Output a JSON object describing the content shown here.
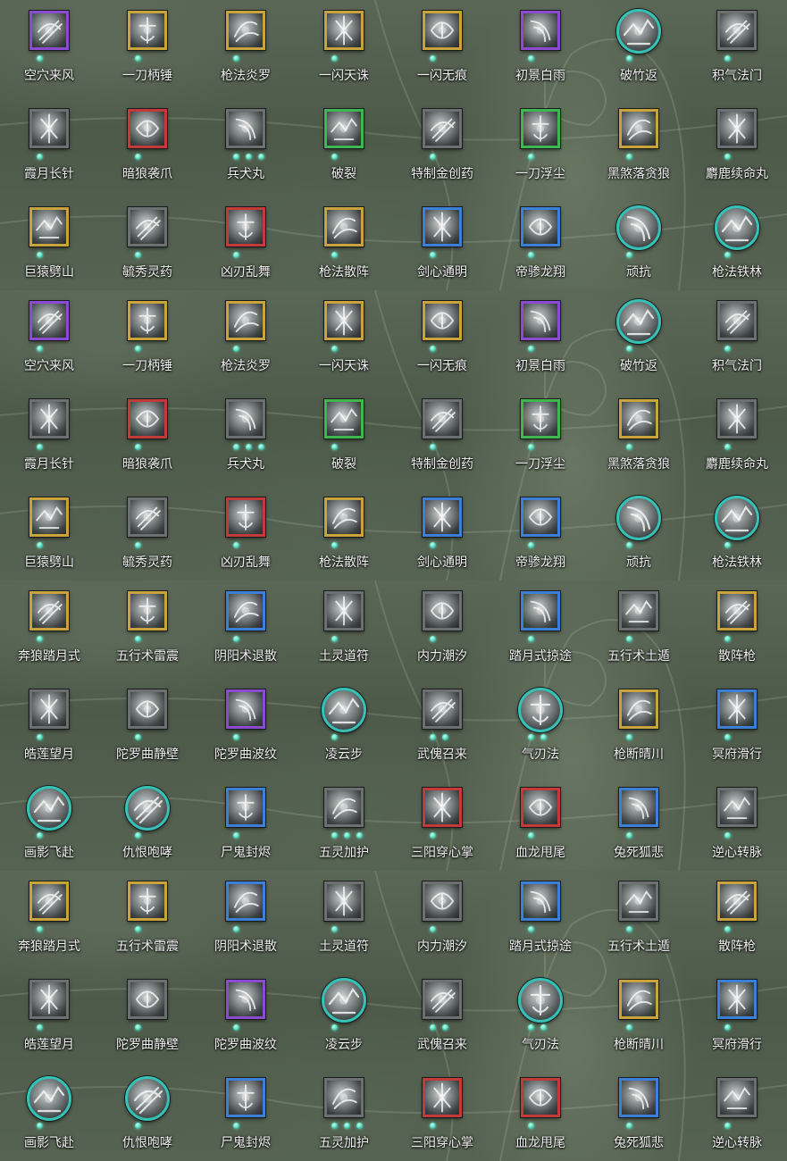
{
  "panels": [
    {
      "rows": [
        [
          {
            "name": "空穴来风",
            "frame": "purple",
            "dots": 1
          },
          {
            "name": "一刀柄锤",
            "frame": "gold",
            "dots": 1
          },
          {
            "name": "枪法炎罗",
            "frame": "gold",
            "dots": 1
          },
          {
            "name": "一闪天诛",
            "frame": "gold",
            "dots": 1
          },
          {
            "name": "一闪无痕",
            "frame": "gold",
            "dots": 1
          },
          {
            "name": "初景白雨",
            "frame": "purple",
            "dots": 1
          },
          {
            "name": "破竹返",
            "frame": "teal-circle",
            "dots": 1
          },
          {
            "name": "积气法门",
            "frame": "gray",
            "dots": 1
          }
        ],
        [
          {
            "name": "霞月长针",
            "frame": "gray",
            "dots": 1
          },
          {
            "name": "暗狼袭爪",
            "frame": "red",
            "dots": 1
          },
          {
            "name": "兵犬丸",
            "frame": "gray",
            "dots": 3
          },
          {
            "name": "破裂",
            "frame": "green",
            "dots": 1
          },
          {
            "name": "特制金创药",
            "frame": "gray",
            "dots": 1
          },
          {
            "name": "一刀浮尘",
            "frame": "green",
            "dots": 1
          },
          {
            "name": "黑煞落贪狼",
            "frame": "gold",
            "dots": 1
          },
          {
            "name": "麝鹿续命丸",
            "frame": "gray",
            "dots": 1
          }
        ],
        [
          {
            "name": "巨猿劈山",
            "frame": "gold",
            "dots": 1
          },
          {
            "name": "毓秀灵药",
            "frame": "gray",
            "dots": 1
          },
          {
            "name": "凶刃乱舞",
            "frame": "red",
            "dots": 1
          },
          {
            "name": "枪法散阵",
            "frame": "gold",
            "dots": 1
          },
          {
            "name": "剑心通明",
            "frame": "blue",
            "dots": 1
          },
          {
            "name": "帝骖龙翔",
            "frame": "blue",
            "dots": 1
          },
          {
            "name": "顽抗",
            "frame": "teal-circle",
            "dots": 1
          },
          {
            "name": "枪法铁林",
            "frame": "teal-circle",
            "dots": 1
          }
        ]
      ]
    },
    {
      "rows": [
        [
          {
            "name": "空穴来风",
            "frame": "purple",
            "dots": 1
          },
          {
            "name": "一刀柄锤",
            "frame": "gold",
            "dots": 1
          },
          {
            "name": "枪法炎罗",
            "frame": "gold",
            "dots": 1
          },
          {
            "name": "一闪天诛",
            "frame": "gold",
            "dots": 1
          },
          {
            "name": "一闪无痕",
            "frame": "gold",
            "dots": 1
          },
          {
            "name": "初景白雨",
            "frame": "purple",
            "dots": 1
          },
          {
            "name": "破竹返",
            "frame": "teal-circle",
            "dots": 1
          },
          {
            "name": "积气法门",
            "frame": "gray",
            "dots": 1
          }
        ],
        [
          {
            "name": "霞月长针",
            "frame": "gray",
            "dots": 1
          },
          {
            "name": "暗狼袭爪",
            "frame": "red",
            "dots": 1
          },
          {
            "name": "兵犬丸",
            "frame": "gray",
            "dots": 3
          },
          {
            "name": "破裂",
            "frame": "green",
            "dots": 1
          },
          {
            "name": "特制金创药",
            "frame": "gray",
            "dots": 1
          },
          {
            "name": "一刀浮尘",
            "frame": "green",
            "dots": 1
          },
          {
            "name": "黑煞落贪狼",
            "frame": "gold",
            "dots": 1
          },
          {
            "name": "麝鹿续命丸",
            "frame": "gray",
            "dots": 1
          }
        ],
        [
          {
            "name": "巨猿劈山",
            "frame": "gold",
            "dots": 1
          },
          {
            "name": "毓秀灵药",
            "frame": "gray",
            "dots": 1
          },
          {
            "name": "凶刃乱舞",
            "frame": "red",
            "dots": 1
          },
          {
            "name": "枪法散阵",
            "frame": "gold",
            "dots": 1
          },
          {
            "name": "剑心通明",
            "frame": "blue",
            "dots": 1
          },
          {
            "name": "帝骖龙翔",
            "frame": "blue",
            "dots": 1
          },
          {
            "name": "顽抗",
            "frame": "teal-circle",
            "dots": 1
          },
          {
            "name": "枪法铁林",
            "frame": "teal-circle",
            "dots": 1
          }
        ]
      ]
    },
    {
      "rows": [
        [
          {
            "name": "奔狼踏月式",
            "frame": "gold",
            "dots": 1
          },
          {
            "name": "五行术雷震",
            "frame": "gold",
            "dots": 1
          },
          {
            "name": "阴阳术退散",
            "frame": "blue",
            "dots": 1
          },
          {
            "name": "土灵道符",
            "frame": "gray",
            "dots": 1
          },
          {
            "name": "内力潮汐",
            "frame": "gray",
            "dots": 1
          },
          {
            "name": "踏月式掠途",
            "frame": "blue",
            "dots": 1
          },
          {
            "name": "五行术土遁",
            "frame": "gray",
            "dots": 1
          },
          {
            "name": "散阵枪",
            "frame": "gold",
            "dots": 1
          }
        ],
        [
          {
            "name": "皓莲望月",
            "frame": "gray",
            "dots": 1
          },
          {
            "name": "陀罗曲静壁",
            "frame": "gray",
            "dots": 1
          },
          {
            "name": "陀罗曲波纹",
            "frame": "purple",
            "dots": 1
          },
          {
            "name": "凌云步",
            "frame": "teal-circle",
            "dots": 1
          },
          {
            "name": "武傀召来",
            "frame": "gray",
            "dots": 2
          },
          {
            "name": "气刃法",
            "frame": "teal-circle",
            "dots": 2
          },
          {
            "name": "枪断晴川",
            "frame": "gold",
            "dots": 1
          },
          {
            "name": "冥府滑行",
            "frame": "blue",
            "dots": 1
          }
        ],
        [
          {
            "name": "画影飞赴",
            "frame": "teal-circle",
            "dots": 1
          },
          {
            "name": "仇恨咆哮",
            "frame": "teal-circle",
            "dots": 1
          },
          {
            "name": "尸鬼封烬",
            "frame": "blue",
            "dots": 1
          },
          {
            "name": "五灵加护",
            "frame": "gray",
            "dots": 3
          },
          {
            "name": "三阳穿心掌",
            "frame": "red",
            "dots": 1
          },
          {
            "name": "血龙甩尾",
            "frame": "red",
            "dots": 1
          },
          {
            "name": "兔死狐悲",
            "frame": "blue",
            "dots": 1
          },
          {
            "name": "逆心转脉",
            "frame": "gray",
            "dots": 1
          }
        ]
      ]
    },
    {
      "rows": [
        [
          {
            "name": "奔狼踏月式",
            "frame": "gold",
            "dots": 1
          },
          {
            "name": "五行术雷震",
            "frame": "gold",
            "dots": 1
          },
          {
            "name": "阴阳术退散",
            "frame": "blue",
            "dots": 1
          },
          {
            "name": "土灵道符",
            "frame": "gray",
            "dots": 1
          },
          {
            "name": "内力潮汐",
            "frame": "gray",
            "dots": 1
          },
          {
            "name": "踏月式掠途",
            "frame": "blue",
            "dots": 1
          },
          {
            "name": "五行术土遁",
            "frame": "gray",
            "dots": 1
          },
          {
            "name": "散阵枪",
            "frame": "gold",
            "dots": 1
          }
        ],
        [
          {
            "name": "皓莲望月",
            "frame": "gray",
            "dots": 1
          },
          {
            "name": "陀罗曲静壁",
            "frame": "gray",
            "dots": 1
          },
          {
            "name": "陀罗曲波纹",
            "frame": "purple",
            "dots": 1
          },
          {
            "name": "凌云步",
            "frame": "teal-circle",
            "dots": 1
          },
          {
            "name": "武傀召来",
            "frame": "gray",
            "dots": 2
          },
          {
            "name": "气刃法",
            "frame": "teal-circle",
            "dots": 2
          },
          {
            "name": "枪断晴川",
            "frame": "gold",
            "dots": 1
          },
          {
            "name": "冥府滑行",
            "frame": "blue",
            "dots": 1
          }
        ],
        [
          {
            "name": "画影飞赴",
            "frame": "teal-circle",
            "dots": 1
          },
          {
            "name": "仇恨咆哮",
            "frame": "teal-circle",
            "dots": 1
          },
          {
            "name": "尸鬼封烬",
            "frame": "blue",
            "dots": 1
          },
          {
            "name": "五灵加护",
            "frame": "gray",
            "dots": 3
          },
          {
            "name": "三阳穿心掌",
            "frame": "red",
            "dots": 1
          },
          {
            "name": "血龙甩尾",
            "frame": "red",
            "dots": 1
          },
          {
            "name": "兔死狐悲",
            "frame": "blue",
            "dots": 1
          },
          {
            "name": "逆心转脉",
            "frame": "gray",
            "dots": 1
          }
        ]
      ]
    }
  ]
}
